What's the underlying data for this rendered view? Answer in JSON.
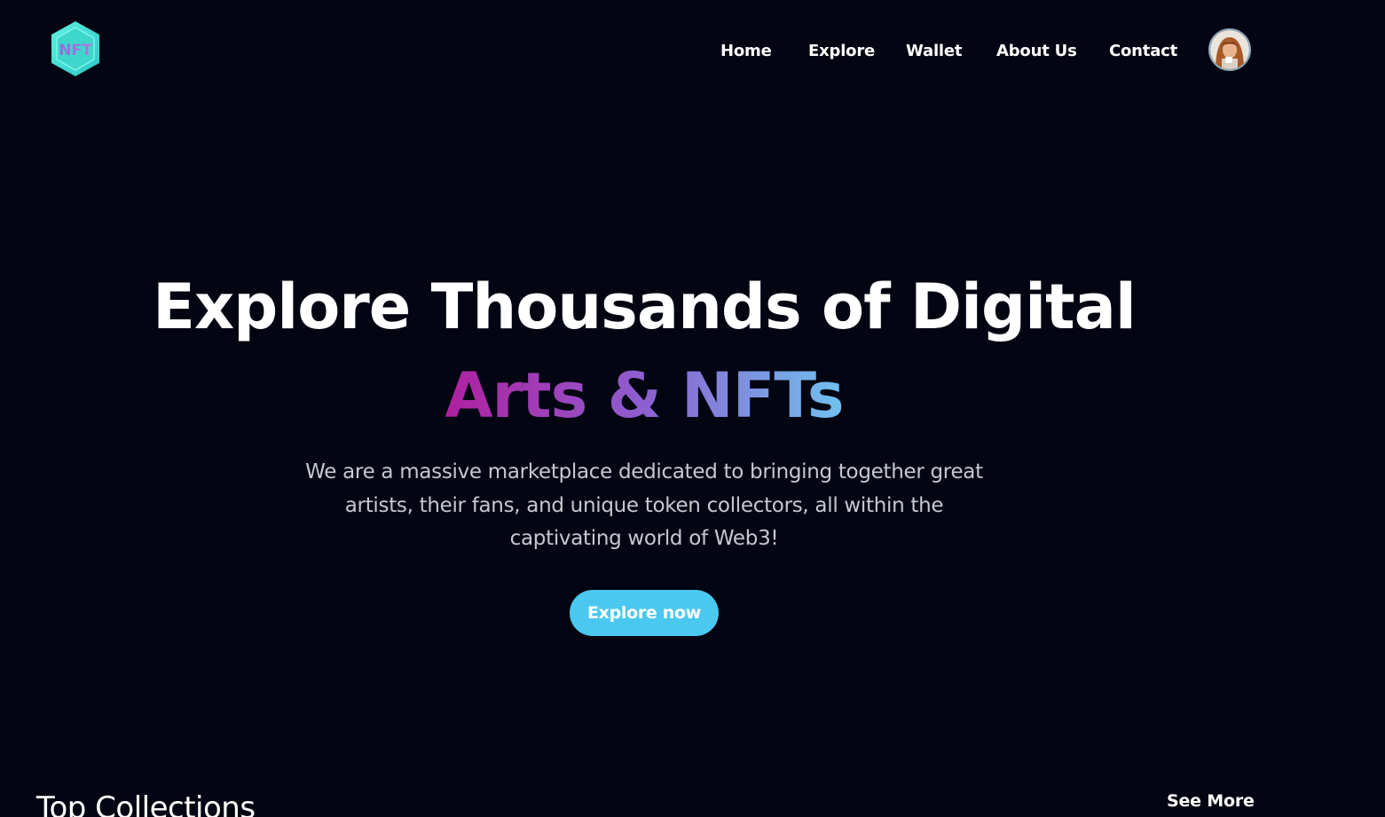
{
  "nav": {
    "logo_text": "NFT",
    "links": [
      {
        "label": "Home"
      },
      {
        "label": "Explore"
      },
      {
        "label": "Wallet"
      },
      {
        "label": "About Us"
      },
      {
        "label": "Contact"
      }
    ]
  },
  "hero": {
    "title_line1": "Explore Thousands of Digital",
    "title_line2": "Arts & NFTs",
    "description": "We are a massive marketplace dedicated to bringing together great artists, their fans, and unique token collectors, all within the captivating world of Web3!",
    "cta_label": "Explore now"
  },
  "collections": {
    "title": "Top Collections",
    "see_more_label": "See More"
  },
  "colors": {
    "background": "#030512",
    "accent": "#4ac8f0",
    "gradient_start": "#b01fa0",
    "gradient_mid": "#8d5fd0",
    "gradient_end": "#6fc2ee",
    "logo": "#3ee0d6"
  },
  "icons": {
    "logo": "nft-hexagon-logo",
    "avatar": "user-avatar"
  }
}
